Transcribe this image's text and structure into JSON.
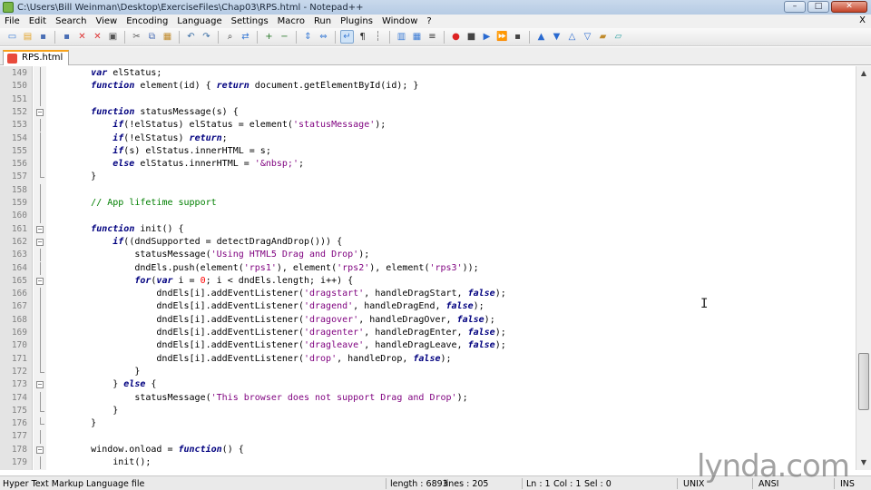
{
  "window": {
    "title": "C:\\Users\\Bill Weinman\\Desktop\\ExerciseFiles\\Chap03\\RPS.html - Notepad++",
    "controls": [
      "–",
      "□",
      "✕"
    ]
  },
  "menu": {
    "items": [
      "File",
      "Edit",
      "Search",
      "View",
      "Encoding",
      "Language",
      "Settings",
      "Macro",
      "Run",
      "Plugins",
      "Window",
      "?"
    ],
    "close": "X"
  },
  "toolbar": {
    "icons": [
      "new-file-icon",
      "open-file-icon",
      "save-icon",
      "save-all-icon",
      "close-icon",
      "close-all-icon",
      "print-icon",
      "cut-icon",
      "copy-icon",
      "paste-icon",
      "undo-icon",
      "redo-icon",
      "find-icon",
      "replace-icon",
      "zoom-in-icon",
      "zoom-out-icon",
      "sync-v-icon",
      "sync-h-icon",
      "word-wrap-icon",
      "show-all-chars-icon",
      "indent-guide-icon",
      "user-lang-icon",
      "doc-map-icon",
      "function-list-icon",
      "record-macro-icon",
      "stop-macro-icon",
      "play-macro-icon",
      "play-multiple-icon",
      "save-macro-icon",
      "collapse-icon",
      "expand-icon",
      "up-icon",
      "down-icon",
      "fold-all-icon",
      "unfold-all-icon"
    ]
  },
  "tab": {
    "label": "RPS.html"
  },
  "editor": {
    "lines": [
      {
        "n": "149",
        "fold": "line",
        "code": [
          [
            "o",
            "        "
          ],
          [
            "k",
            "var"
          ],
          [
            "o",
            " elStatus;"
          ]
        ]
      },
      {
        "n": "150",
        "fold": "line",
        "code": [
          [
            "o",
            "        "
          ],
          [
            "k",
            "function"
          ],
          [
            "o",
            " element(id) { "
          ],
          [
            "k",
            "return"
          ],
          [
            "o",
            " document.getElementById(id); }"
          ]
        ]
      },
      {
        "n": "151",
        "fold": "line",
        "code": [
          [
            "o",
            ""
          ]
        ]
      },
      {
        "n": "152",
        "fold": "box",
        "code": [
          [
            "o",
            "        "
          ],
          [
            "k",
            "function"
          ],
          [
            "o",
            " statusMessage(s) {"
          ]
        ]
      },
      {
        "n": "153",
        "fold": "line",
        "code": [
          [
            "o",
            "            "
          ],
          [
            "k",
            "if"
          ],
          [
            "o",
            "(!elStatus) elStatus = element("
          ],
          [
            "s",
            "'statusMessage'"
          ],
          [
            "o",
            ");"
          ]
        ]
      },
      {
        "n": "154",
        "fold": "line",
        "code": [
          [
            "o",
            "            "
          ],
          [
            "k",
            "if"
          ],
          [
            "o",
            "(!elStatus) "
          ],
          [
            "k",
            "return"
          ],
          [
            "o",
            ";"
          ]
        ]
      },
      {
        "n": "155",
        "fold": "line",
        "code": [
          [
            "o",
            "            "
          ],
          [
            "k",
            "if"
          ],
          [
            "o",
            "(s) elStatus.innerHTML = s;"
          ]
        ]
      },
      {
        "n": "156",
        "fold": "line",
        "code": [
          [
            "o",
            "            "
          ],
          [
            "k",
            "else"
          ],
          [
            "o",
            " elStatus.innerHTML = "
          ],
          [
            "s",
            "'&nbsp;'"
          ],
          [
            "o",
            ";"
          ]
        ]
      },
      {
        "n": "157",
        "fold": "end",
        "code": [
          [
            "o",
            "        }"
          ]
        ]
      },
      {
        "n": "158",
        "fold": "line",
        "code": [
          [
            "o",
            ""
          ]
        ]
      },
      {
        "n": "159",
        "fold": "line",
        "code": [
          [
            "o",
            "        "
          ],
          [
            "c",
            "// App lifetime support"
          ]
        ]
      },
      {
        "n": "160",
        "fold": "line",
        "code": [
          [
            "o",
            ""
          ]
        ]
      },
      {
        "n": "161",
        "fold": "box",
        "code": [
          [
            "o",
            "        "
          ],
          [
            "k",
            "function"
          ],
          [
            "o",
            " init() {"
          ]
        ]
      },
      {
        "n": "162",
        "fold": "box",
        "code": [
          [
            "o",
            "            "
          ],
          [
            "k",
            "if"
          ],
          [
            "o",
            "((dndSupported = detectDragAndDrop())) {"
          ]
        ]
      },
      {
        "n": "163",
        "fold": "line",
        "code": [
          [
            "o",
            "                statusMessage("
          ],
          [
            "s",
            "'Using HTML5 Drag and Drop'"
          ],
          [
            "o",
            ");"
          ]
        ]
      },
      {
        "n": "164",
        "fold": "line",
        "code": [
          [
            "o",
            "                dndEls.push(element("
          ],
          [
            "s",
            "'rps1'"
          ],
          [
            "o",
            "), element("
          ],
          [
            "s",
            "'rps2'"
          ],
          [
            "o",
            "), element("
          ],
          [
            "s",
            "'rps3'"
          ],
          [
            "o",
            "));"
          ]
        ]
      },
      {
        "n": "165",
        "fold": "box",
        "code": [
          [
            "o",
            "                "
          ],
          [
            "k",
            "for"
          ],
          [
            "o",
            "("
          ],
          [
            "k",
            "var"
          ],
          [
            "o",
            " i = "
          ],
          [
            "n",
            "0"
          ],
          [
            "o",
            "; i < dndEls.length; i++) {"
          ]
        ]
      },
      {
        "n": "166",
        "fold": "line",
        "code": [
          [
            "o",
            "                    dndEls[i].addEventListener("
          ],
          [
            "s",
            "'dragstart'"
          ],
          [
            "o",
            ", handleDragStart, "
          ],
          [
            "k",
            "false"
          ],
          [
            "o",
            ");"
          ]
        ]
      },
      {
        "n": "167",
        "fold": "line",
        "code": [
          [
            "o",
            "                    dndEls[i].addEventListener("
          ],
          [
            "s",
            "'dragend'"
          ],
          [
            "o",
            ", handleDragEnd, "
          ],
          [
            "k",
            "false"
          ],
          [
            "o",
            ");"
          ]
        ]
      },
      {
        "n": "168",
        "fold": "line",
        "code": [
          [
            "o",
            "                    dndEls[i].addEventListener("
          ],
          [
            "s",
            "'dragover'"
          ],
          [
            "o",
            ", handleDragOver, "
          ],
          [
            "k",
            "false"
          ],
          [
            "o",
            ");"
          ]
        ]
      },
      {
        "n": "169",
        "fold": "line",
        "code": [
          [
            "o",
            "                    dndEls[i].addEventListener("
          ],
          [
            "s",
            "'dragenter'"
          ],
          [
            "o",
            ", handleDragEnter, "
          ],
          [
            "k",
            "false"
          ],
          [
            "o",
            ");"
          ]
        ]
      },
      {
        "n": "170",
        "fold": "line",
        "code": [
          [
            "o",
            "                    dndEls[i].addEventListener("
          ],
          [
            "s",
            "'dragleave'"
          ],
          [
            "o",
            ", handleDragLeave, "
          ],
          [
            "k",
            "false"
          ],
          [
            "o",
            ");"
          ]
        ]
      },
      {
        "n": "171",
        "fold": "line",
        "code": [
          [
            "o",
            "                    dndEls[i].addEventListener("
          ],
          [
            "s",
            "'drop'"
          ],
          [
            "o",
            ", handleDrop, "
          ],
          [
            "k",
            "false"
          ],
          [
            "o",
            ");"
          ]
        ]
      },
      {
        "n": "172",
        "fold": "end",
        "code": [
          [
            "o",
            "                }"
          ]
        ]
      },
      {
        "n": "173",
        "fold": "box",
        "code": [
          [
            "o",
            "            } "
          ],
          [
            "k",
            "else"
          ],
          [
            "o",
            " {"
          ]
        ]
      },
      {
        "n": "174",
        "fold": "line",
        "code": [
          [
            "o",
            "                statusMessage("
          ],
          [
            "s",
            "'This browser does not support Drag and Drop'"
          ],
          [
            "o",
            ");"
          ]
        ]
      },
      {
        "n": "175",
        "fold": "end",
        "code": [
          [
            "o",
            "            }"
          ]
        ]
      },
      {
        "n": "176",
        "fold": "end",
        "code": [
          [
            "o",
            "        }"
          ]
        ]
      },
      {
        "n": "177",
        "fold": "line",
        "code": [
          [
            "o",
            ""
          ]
        ]
      },
      {
        "n": "178",
        "fold": "box",
        "code": [
          [
            "o",
            "        window.onload = "
          ],
          [
            "k",
            "function"
          ],
          [
            "o",
            "() {"
          ]
        ]
      },
      {
        "n": "179",
        "fold": "line",
        "code": [
          [
            "o",
            "            init();"
          ]
        ]
      }
    ]
  },
  "status": {
    "language": "Hyper Text Markup Language file",
    "length": "length : 6893",
    "lines": "lines : 205",
    "ln": "Ln : 1",
    "col": "Col : 1",
    "sel": "Sel : 0",
    "eol": "UNIX",
    "encoding": "ANSI",
    "mode": "INS"
  },
  "watermark": "lynda.com"
}
